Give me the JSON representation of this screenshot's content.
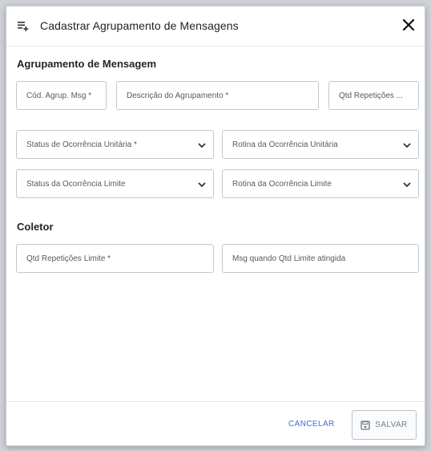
{
  "dialog": {
    "title": "Cadastrar Agrupamento de Mensagens",
    "title_icon": "playlist-add-icon",
    "close_icon": "close-icon"
  },
  "section_agrupamento": {
    "title": "Agrupamento de Mensagem",
    "cod_agrup_label": "Cód. Agrup. Msg *",
    "descricao_label": "Descrição do Agrupamento *",
    "qtd_repeticoes_label": "Qtd Repetições ...",
    "status_unitaria_label": "Status de Ocorrência Unitária *",
    "rotina_unitaria_label": "Rotina da Ocorrência Unitária",
    "status_limite_label": "Status da Ocorrência Limite",
    "rotina_limite_label": "Rotina da Ocorrência Limite"
  },
  "section_coletor": {
    "title": "Coletor",
    "qtd_repeticoes_limite_label": "Qtd Repetições Limite *",
    "msg_qtd_limite_label": "Msg quando Qtd Limite atingida"
  },
  "footer": {
    "cancel_label": "CANCELAR",
    "save_label": "SALVAR",
    "save_icon": "save-icon"
  },
  "colors": {
    "accent": "#3a6fd0",
    "border": "#c3c7cc",
    "text": "#222222"
  }
}
